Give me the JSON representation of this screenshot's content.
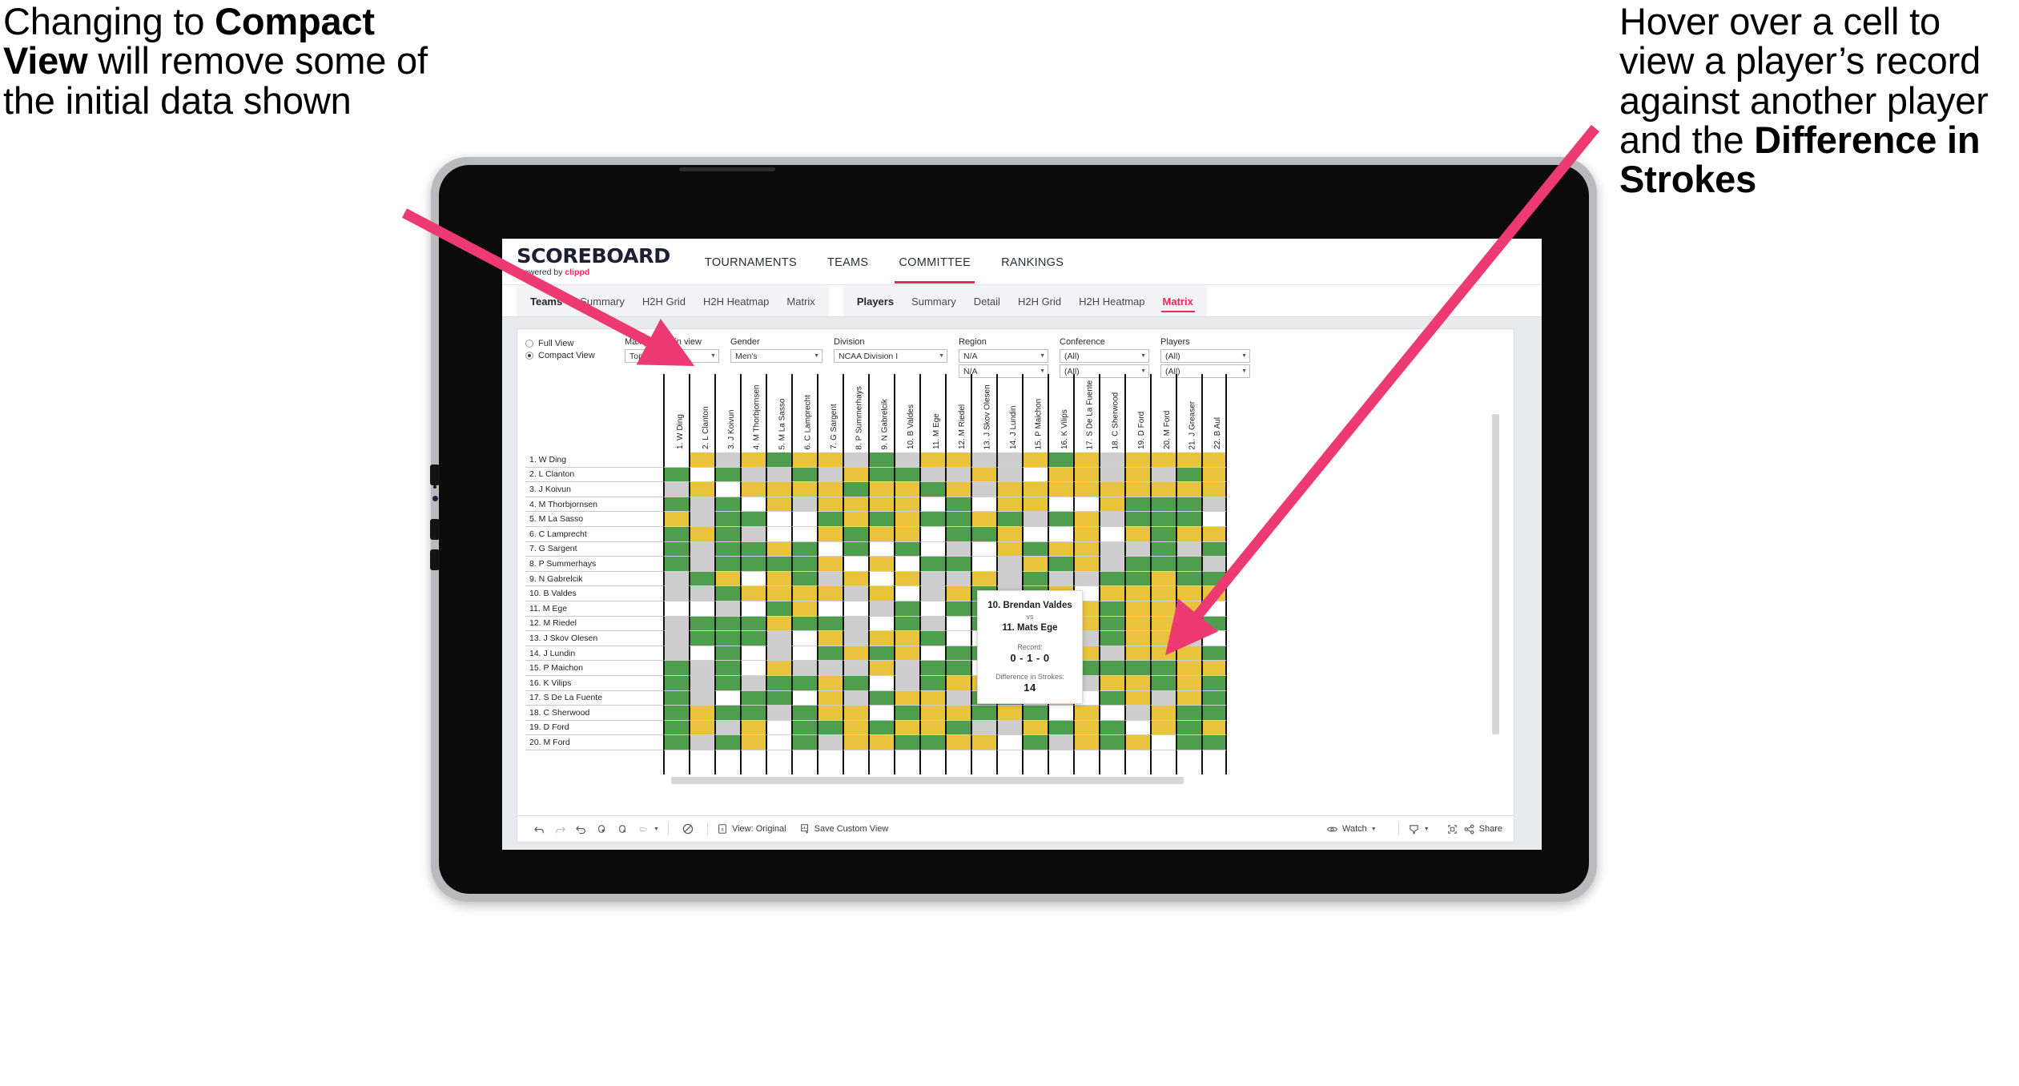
{
  "annotations": {
    "left": {
      "pre": "Changing to ",
      "bold": "Compact View",
      "post": " will remove some of the initial data shown"
    },
    "right": {
      "pre": "Hover over a cell to view a player’s record against another player and the ",
      "bold": "Difference in Strokes",
      "post": ""
    }
  },
  "brand": {
    "name": "SCOREBOARD",
    "powered_prefix": "Powered by ",
    "powered_brand": "clippd"
  },
  "topnav": [
    {
      "label": "TOURNAMENTS",
      "active": false
    },
    {
      "label": "TEAMS",
      "active": false
    },
    {
      "label": "COMMITTEE",
      "active": true
    },
    {
      "label": "RANKINGS",
      "active": false
    }
  ],
  "subnav": {
    "group1": [
      {
        "label": "Teams",
        "lead": true,
        "active": false
      },
      {
        "label": "Summary",
        "lead": false,
        "active": false
      },
      {
        "label": "H2H Grid",
        "lead": false,
        "active": false
      },
      {
        "label": "H2H Heatmap",
        "lead": false,
        "active": false
      },
      {
        "label": "Matrix",
        "lead": false,
        "active": false
      }
    ],
    "group2": [
      {
        "label": "Players",
        "lead": true,
        "active": false
      },
      {
        "label": "Summary",
        "lead": false,
        "active": false
      },
      {
        "label": "Detail",
        "lead": false,
        "active": false
      },
      {
        "label": "H2H Grid",
        "lead": false,
        "active": false
      },
      {
        "label": "H2H Heatmap",
        "lead": false,
        "active": false
      },
      {
        "label": "Matrix",
        "lead": false,
        "active": true
      }
    ]
  },
  "filters": {
    "view_mode": {
      "full": "Full View",
      "compact": "Compact View",
      "selected": "Compact View"
    },
    "max_players": {
      "label": "Max players in view",
      "value": "Top 25"
    },
    "gender": {
      "label": "Gender",
      "value": "Men's"
    },
    "division": {
      "label": "Division",
      "value": "NCAA Division I"
    },
    "region": {
      "label": "Region",
      "value1": "N/A",
      "value2": "N/A"
    },
    "conference": {
      "label": "Conference",
      "value1": "(All)",
      "value2": "(All)"
    },
    "players": {
      "label": "Players",
      "value1": "(All)",
      "value2": "(All)"
    }
  },
  "matrix": {
    "rows": [
      "1. W Ding",
      "2. L Clanton",
      "3. J Koivun",
      "4. M Thorbjornsen",
      "5. M La Sasso",
      "6. C Lamprecht",
      "7. G Sargent",
      "8. P Summerhays",
      "9. N Gabrelcik",
      "10. B Valdes",
      "11. M Ege",
      "12. M Riedel",
      "13. J Skov Olesen",
      "14. J Lundin",
      "15. P Maichon",
      "16. K Vilips",
      "17. S De La Fuente",
      "18. C Sherwood",
      "19. D Ford",
      "20. M Ford"
    ],
    "columns": [
      "1. W Ding",
      "2. L Clanton",
      "3. J Koivun",
      "4. M Thorbjornsen",
      "5. M La Sasso",
      "6. C Lamprecht",
      "7. G Sargent",
      "8. P Summerhays",
      "9. N Gabrelcik",
      "10. B Valdes",
      "11. M Ege",
      "12. M Riedel",
      "13. J Skov Olesen",
      "14. J Lundin",
      "15. P Maichon",
      "16. K Vilips",
      "17. S De La Fuente",
      "18. C Sherwood",
      "19. D Ford",
      "20. M Ford",
      "21. J Greaser",
      "22. B Aul"
    ],
    "legend": {
      "win": "#4f9e4d",
      "loss": "#e9c33c",
      "tie": "#cdcdcd",
      "self": "#ffffff"
    },
    "cells": [
      [
        "w",
        "y",
        "a",
        "y",
        "g",
        "y",
        "y",
        "a",
        "g",
        "a",
        "y",
        "y",
        "a",
        "a",
        "y",
        "g",
        "y",
        "a",
        "y",
        "y",
        "y",
        "y"
      ],
      [
        "g",
        "w",
        "g",
        "a",
        "a",
        "g",
        "a",
        "y",
        "g",
        "g",
        "a",
        "a",
        "y",
        "a",
        "w",
        "y",
        "y",
        "a",
        "y",
        "a",
        "g",
        "y"
      ],
      [
        "a",
        "y",
        "w",
        "y",
        "y",
        "y",
        "y",
        "g",
        "y",
        "y",
        "g",
        "y",
        "a",
        "y",
        "y",
        "y",
        "y",
        "y",
        "y",
        "y",
        "y",
        "y"
      ],
      [
        "g",
        "a",
        "g",
        "w",
        "y",
        "a",
        "y",
        "y",
        "y",
        "y",
        "w",
        "g",
        "w",
        "y",
        "y",
        "w",
        "w",
        "y",
        "g",
        "g",
        "g",
        "a"
      ],
      [
        "y",
        "a",
        "g",
        "g",
        "w",
        "w",
        "g",
        "y",
        "g",
        "y",
        "g",
        "g",
        "y",
        "g",
        "a",
        "g",
        "y",
        "a",
        "g",
        "g",
        "g",
        "w"
      ],
      [
        "g",
        "y",
        "g",
        "a",
        "w",
        "w",
        "y",
        "g",
        "y",
        "y",
        "w",
        "g",
        "g",
        "y",
        "w",
        "w",
        "y",
        "w",
        "y",
        "g",
        "y",
        "y"
      ],
      [
        "g",
        "a",
        "g",
        "g",
        "y",
        "g",
        "w",
        "g",
        "w",
        "g",
        "w",
        "a",
        "w",
        "y",
        "g",
        "y",
        "y",
        "a",
        "a",
        "g",
        "a",
        "g"
      ],
      [
        "g",
        "a",
        "g",
        "g",
        "g",
        "g",
        "y",
        "w",
        "y",
        "w",
        "g",
        "g",
        "w",
        "a",
        "y",
        "g",
        "y",
        "a",
        "g",
        "g",
        "g",
        "a"
      ],
      [
        "a",
        "g",
        "y",
        "w",
        "y",
        "g",
        "a",
        "y",
        "w",
        "y",
        "a",
        "a",
        "y",
        "a",
        "g",
        "a",
        "a",
        "g",
        "g",
        "y",
        "g",
        "g"
      ],
      [
        "a",
        "a",
        "g",
        "y",
        "y",
        "y",
        "y",
        "a",
        "y",
        "w",
        "a",
        "y",
        "g",
        "a",
        "g",
        "y",
        "w",
        "y",
        "y",
        "y",
        "y",
        "y"
      ],
      [
        "w",
        "w",
        "a",
        "w",
        "g",
        "y",
        "w",
        "w",
        "a",
        "g",
        "w",
        "g",
        "g",
        "y",
        "a",
        "g",
        "y",
        "g",
        "y",
        "y",
        "y",
        "w"
      ],
      [
        "a",
        "g",
        "g",
        "g",
        "y",
        "g",
        "g",
        "a",
        "w",
        "g",
        "a",
        "w",
        "g",
        "g",
        "a",
        "g",
        "y",
        "g",
        "y",
        "y",
        "y",
        "g"
      ],
      [
        "a",
        "g",
        "g",
        "g",
        "a",
        "w",
        "y",
        "a",
        "y",
        "y",
        "g",
        "w",
        "w",
        "y",
        "g",
        "a",
        "a",
        "g",
        "y",
        "y",
        "a",
        "w"
      ],
      [
        "a",
        "w",
        "g",
        "w",
        "a",
        "w",
        "g",
        "y",
        "g",
        "y",
        "w",
        "g",
        "g",
        "w",
        "y",
        "w",
        "y",
        "a",
        "y",
        "y",
        "y",
        "g"
      ],
      [
        "g",
        "a",
        "g",
        "w",
        "y",
        "a",
        "a",
        "a",
        "y",
        "a",
        "g",
        "g",
        "w",
        "g",
        "w",
        "a",
        "g",
        "g",
        "g",
        "g",
        "y",
        "y"
      ],
      [
        "g",
        "a",
        "g",
        "a",
        "g",
        "g",
        "y",
        "g",
        "w",
        "a",
        "g",
        "y",
        "y",
        "g",
        "w",
        "w",
        "a",
        "y",
        "y",
        "g",
        "y",
        "g"
      ],
      [
        "g",
        "a",
        "w",
        "g",
        "g",
        "w",
        "y",
        "a",
        "g",
        "y",
        "y",
        "a",
        "g",
        "g",
        "a",
        "y",
        "w",
        "g",
        "y",
        "a",
        "y",
        "g"
      ],
      [
        "g",
        "y",
        "g",
        "g",
        "a",
        "g",
        "y",
        "y",
        "w",
        "g",
        "y",
        "y",
        "g",
        "y",
        "g",
        "w",
        "y",
        "w",
        "a",
        "y",
        "g",
        "g"
      ],
      [
        "g",
        "y",
        "a",
        "y",
        "w",
        "g",
        "g",
        "y",
        "g",
        "y",
        "y",
        "g",
        "a",
        "a",
        "y",
        "g",
        "y",
        "g",
        "w",
        "y",
        "g",
        "y"
      ],
      [
        "g",
        "a",
        "g",
        "y",
        "w",
        "g",
        "a",
        "y",
        "y",
        "g",
        "g",
        "y",
        "y",
        "w",
        "g",
        "a",
        "y",
        "g",
        "y",
        "w",
        "g",
        "g"
      ]
    ]
  },
  "tooltip": {
    "player_a": "10. Brendan Valdes",
    "vs": "vs",
    "player_b": "11. Mats Ege",
    "record_label": "Record:",
    "record_value": "0 - 1 - 0",
    "diff_label": "Difference in Strokes:",
    "diff_value": "14"
  },
  "toolbar": {
    "icons": [
      "undo-icon",
      "redo-icon",
      "revert-icon",
      "refresh-icon",
      "pause-icon",
      "highlight-icon"
    ],
    "view_original": "View: Original",
    "save_custom_view": "Save Custom View",
    "watch": "Watch",
    "share": "Share"
  }
}
